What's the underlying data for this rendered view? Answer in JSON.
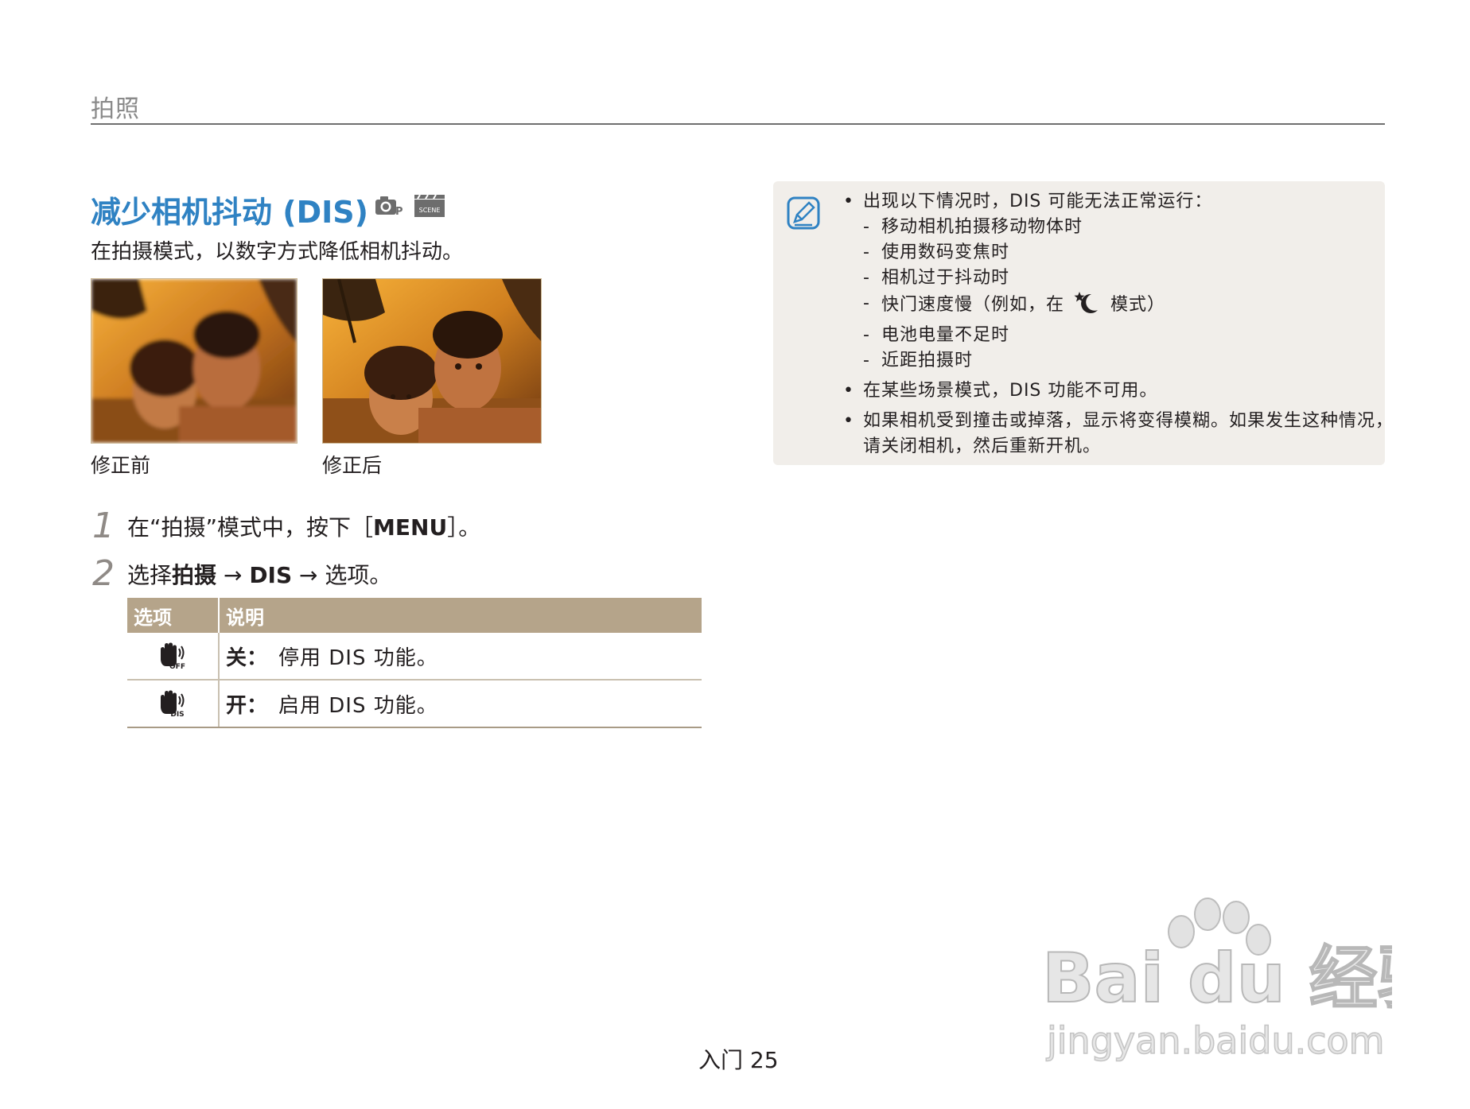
{
  "header": {
    "title": "拍照"
  },
  "section": {
    "title": "减少相机抖动 (DIS)",
    "intro": "在拍摄模式，以数字方式降低相机抖动。",
    "mode_icons": [
      "camera-program-icon",
      "scene-icon"
    ],
    "scene_icon_label": "SCENE"
  },
  "photos": {
    "before_caption": "修正前",
    "after_caption": "修正后"
  },
  "steps": [
    {
      "number": "1",
      "before": "在“拍摄”模式中，按下［",
      "key": "MENU",
      "after": "］。"
    },
    {
      "number": "2",
      "prefix": "选择",
      "bold": "拍摄",
      "arrow": "→",
      "dis": "DIS",
      "suffix": "选项。"
    }
  ],
  "options_table": {
    "headers": [
      "选项",
      "说明"
    ],
    "rows": [
      {
        "icon": "dis-off-icon",
        "icon_label": "OFF",
        "name": "关：",
        "desc": "停用 DIS 功能。"
      },
      {
        "icon": "dis-on-icon",
        "icon_label": "DIS",
        "name": "开：",
        "desc": "启用 DIS 功能。"
      }
    ]
  },
  "note": {
    "icon": "note-pencil-icon",
    "item1": "出现以下情况时，DIS 可能无法正常运行：",
    "subs": [
      "移动相机拍摄移动物体时",
      "使用数码变焦时",
      "相机过于抖动时"
    ],
    "sub4_before": "快门速度慢（例如，在",
    "sub4_after": "模式）",
    "sub4_icon": "night-mode-icon",
    "subs2": [
      "电池电量不足时",
      "近距拍摄时"
    ],
    "item2": "在某些场景模式，DIS 功能不可用。",
    "item3_line1": "如果相机受到撞击或掉落，显示将变得模糊。如果发生这种情况，",
    "item3_line2": "请关闭相机，然后重新开机。"
  },
  "watermark": {
    "brand": "Bai du 经验",
    "url": "jingyan.baidu.com"
  },
  "footer": {
    "text": "入门 25"
  },
  "colors": {
    "accent": "#2f82c3",
    "table_header": "#b5a48a",
    "note_bg": "#f1eeea"
  }
}
